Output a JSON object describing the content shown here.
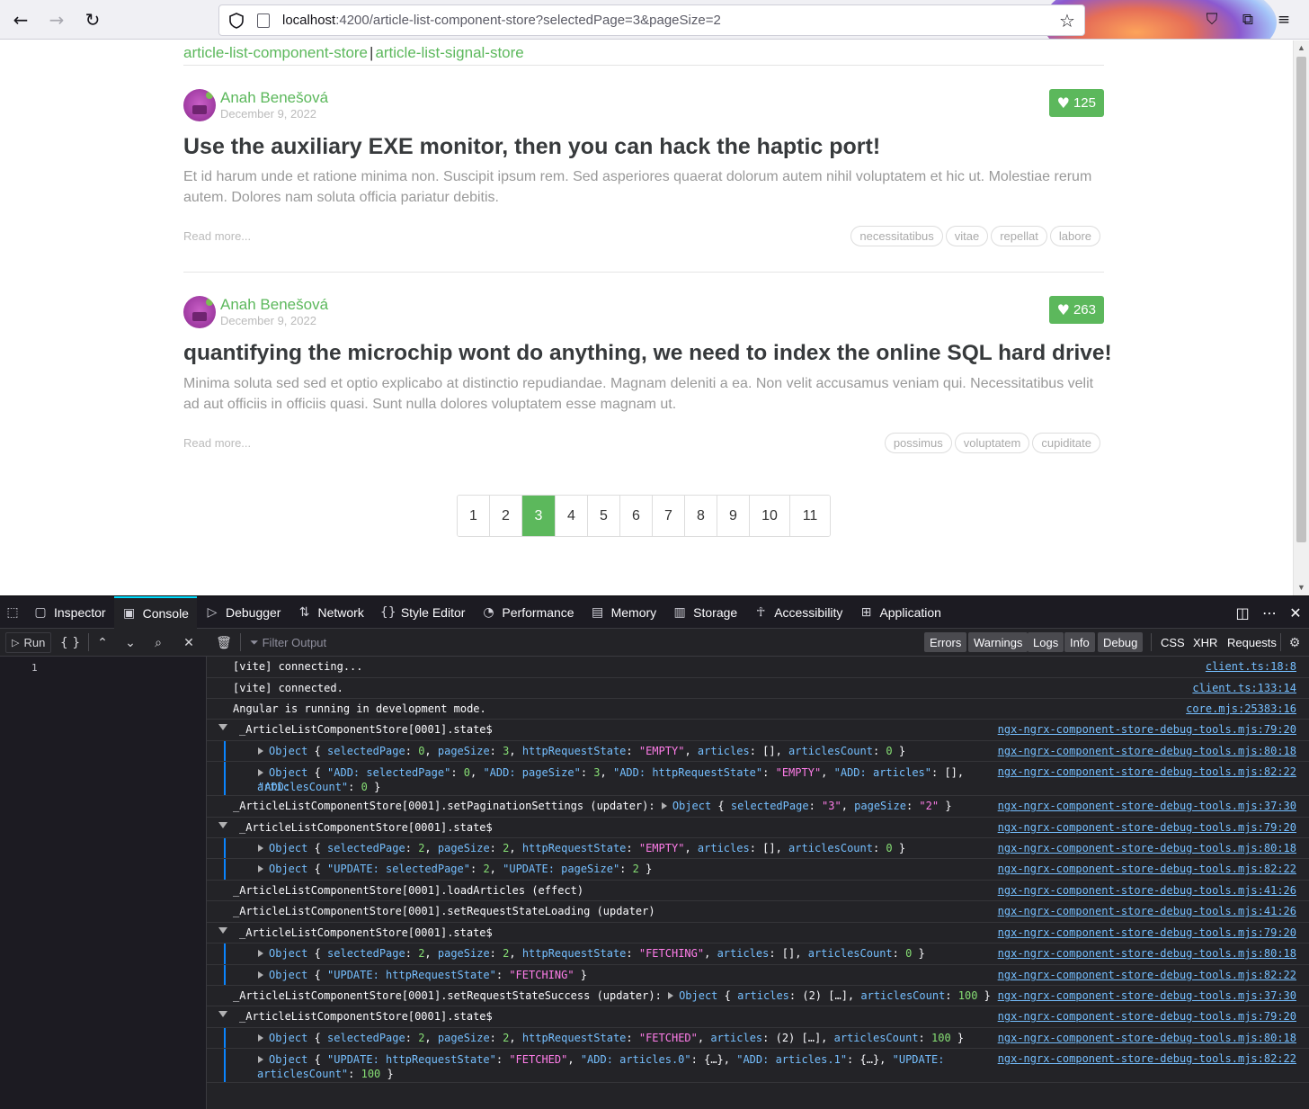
{
  "browser": {
    "url_host": "localhost",
    "url_path": ":4200/article-list-component-store?selectedPage=3&pageSize=2"
  },
  "nav": {
    "link1": "article-list-component-store",
    "separator": "|",
    "link2": "article-list-signal-store"
  },
  "articles": [
    {
      "author": "Anah Benešová",
      "date": "December 9, 2022",
      "likes": "125",
      "title": "Use the auxiliary EXE monitor, then you can hack the haptic port!",
      "body": "Et id harum unde et ratione minima non. Suscipit ipsum rem. Sed asperiores quaerat dolorum autem nihil voluptatem et hic ut. Molestiae rerum autem. Dolores nam soluta officia pariatur debitis.",
      "read_more": "Read more...",
      "tags": [
        "necessitatibus",
        "vitae",
        "repellat",
        "labore"
      ]
    },
    {
      "author": "Anah Benešová",
      "date": "December 9, 2022",
      "likes": "263",
      "title": "quantifying the microchip wont do anything, we need to index the online SQL hard drive!",
      "body": "Minima soluta sed sed et optio explicabo at distinctio repudiandae. Magnam deleniti a ea. Non velit accusamus veniam qui. Necessitatibus velit ad aut officiis in officiis quasi. Sunt nulla dolores voluptatem esse magnam ut.",
      "read_more": "Read more...",
      "tags": [
        "possimus",
        "voluptatem",
        "cupiditate"
      ]
    }
  ],
  "pagination": {
    "pages": [
      "1",
      "2",
      "3",
      "4",
      "5",
      "6",
      "7",
      "8",
      "9",
      "10",
      "11"
    ],
    "selected": "3"
  },
  "devtools": {
    "tabs": [
      "Inspector",
      "Console",
      "Debugger",
      "Network",
      "Style Editor",
      "Performance",
      "Memory",
      "Storage",
      "Accessibility",
      "Application"
    ],
    "selected_tab": "Console",
    "run_label": "Run",
    "filter_placeholder": "Filter Output",
    "levels": [
      "Errors",
      "Warnings",
      "Logs",
      "Info",
      "Debug"
    ],
    "extra_filters": [
      "CSS",
      "XHR",
      "Requests"
    ],
    "editor_line": "1",
    "console": {
      "m1": "[vite] connecting...",
      "s1": "client.ts:18:8",
      "m2": "[vite] connected.",
      "s2": "client.ts:133:14",
      "m3": "Angular is running in development mode.",
      "s3": "core.mjs:25383:16",
      "m4": "_ArticleListComponentStore[0001].state$",
      "s4": "ngx-ngrx-component-store-debug-tools.mjs:79:20",
      "s5": "ngx-ngrx-component-store-debug-tools.mjs:80:18",
      "s6": "ngx-ngrx-component-store-debug-tools.mjs:82:22",
      "m7": "_ArticleListComponentStore[0001].setPaginationSettings (updater): ",
      "s7": "ngx-ngrx-component-store-debug-tools.mjs:37:30",
      "m8": "_ArticleListComponentStore[0001].state$",
      "s8": "ngx-ngrx-component-store-debug-tools.mjs:79:20",
      "s9": "ngx-ngrx-component-store-debug-tools.mjs:80:18",
      "s10": "ngx-ngrx-component-store-debug-tools.mjs:82:22",
      "m11": "_ArticleListComponentStore[0001].loadArticles (effect)",
      "s11": "ngx-ngrx-component-store-debug-tools.mjs:41:26",
      "m12": "_ArticleListComponentStore[0001].setRequestStateLoading (updater)",
      "s12": "ngx-ngrx-component-store-debug-tools.mjs:41:26",
      "m13": "_ArticleListComponentStore[0001].state$",
      "s13": "ngx-ngrx-component-store-debug-tools.mjs:79:20",
      "s14": "ngx-ngrx-component-store-debug-tools.mjs:80:18",
      "s15": "ngx-ngrx-component-store-debug-tools.mjs:82:22",
      "m16": "_ArticleListComponentStore[0001].setRequestStateSuccess (updater): ",
      "s16": "ngx-ngrx-component-store-debug-tools.mjs:37:30",
      "m17": "_ArticleListComponentStore[0001].state$",
      "s17": "ngx-ngrx-component-store-debug-tools.mjs:79:20",
      "s18": "ngx-ngrx-component-store-debug-tools.mjs:80:18",
      "s19": "ngx-ngrx-component-store-debug-tools.mjs:82:22"
    }
  },
  "colors": {
    "accent_green": "#5cb85c",
    "devtools_bg": "#232327",
    "link_blue": "#75bfff",
    "string_pink": "#ff7de9",
    "number_green": "#86de74"
  }
}
